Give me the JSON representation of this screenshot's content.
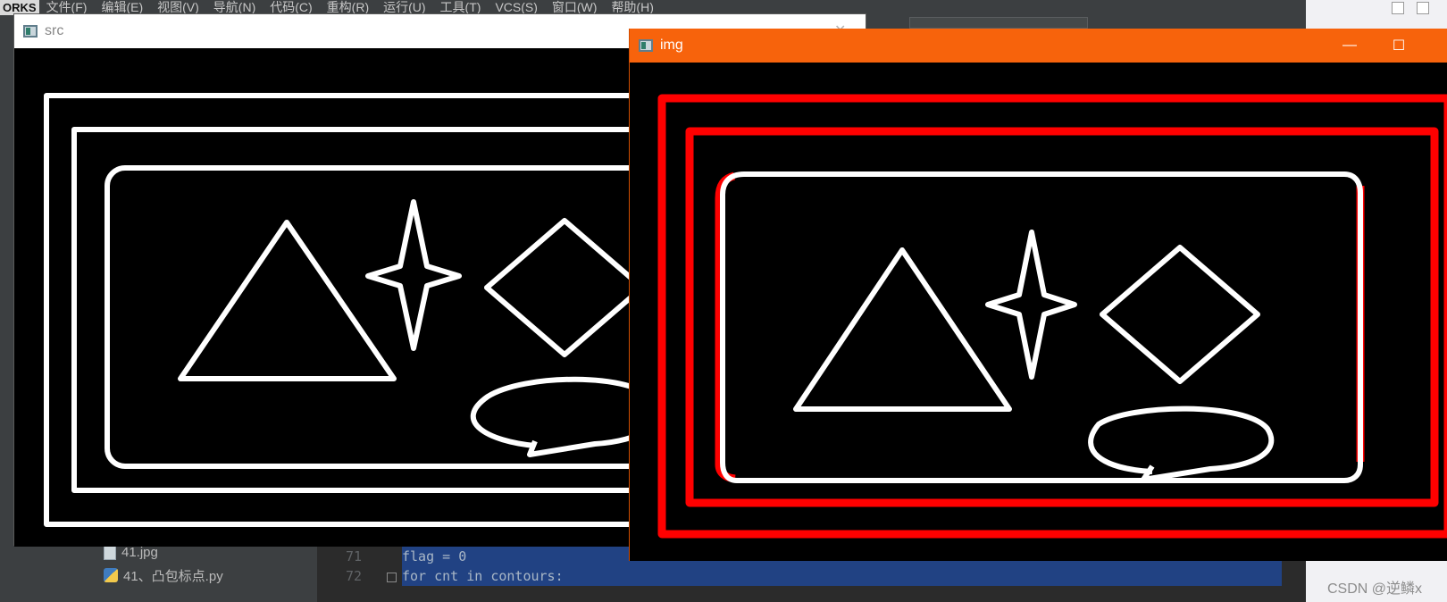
{
  "menubar": {
    "logo": "ORKS",
    "items": [
      "文件(F)",
      "编辑(E)",
      "视图(V)",
      "导航(N)",
      "代码(C)",
      "重构(R)",
      "运行(U)",
      "工具(T)",
      "VCS(S)",
      "窗口(W)",
      "帮助(H)"
    ]
  },
  "project_tree": {
    "items": [
      {
        "label": "41.jpg",
        "icon": "image-file-icon"
      },
      {
        "label": "41、凸包标点.py",
        "icon": "python-file-icon"
      }
    ]
  },
  "editor": {
    "lines": [
      {
        "number": "71",
        "code": "flag = 0"
      },
      {
        "number": "72",
        "code": "for cnt in contours:"
      }
    ]
  },
  "windows": {
    "src": {
      "title": "src",
      "controls": [
        "minimize-icon",
        "close-icon"
      ]
    },
    "img": {
      "title": "img",
      "controls": [
        "minimize-icon",
        "maximize-icon"
      ]
    }
  },
  "colors": {
    "img_titlebar": "#f7630c",
    "contour_red": "#ff0000",
    "shape_white": "#ffffff",
    "canvas_black": "#000000",
    "selection": "#214283"
  },
  "watermark": "CSDN @逆鳞x"
}
